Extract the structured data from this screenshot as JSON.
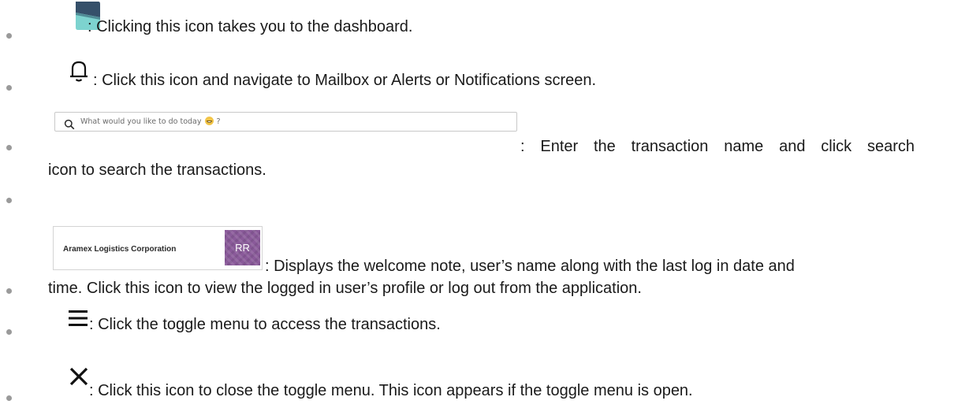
{
  "items": [
    {
      "icon": "dashboard-logo-icon",
      "text": ": Clicking this icon takes you to the dashboard."
    },
    {
      "icon": "bell-icon",
      "text": ": Click this icon and navigate to Mailbox or Alerts or Notifications screen."
    },
    {
      "icon": "search-icon",
      "search_placeholder_before": "What would you like to do today",
      "search_placeholder_after": "?",
      "emoji_icon": "grinning-face-icon",
      "text_line1": ": Enter the transaction name and click search",
      "text_line2": "icon to search the transactions."
    },
    {
      "text": ""
    },
    {
      "company": "Aramex Logistics Corporation",
      "avatar_initials": "RR",
      "text_line1": ": Displays the welcome note, user’s name along with the last log in date and",
      "text_line2": "time. Click this icon to view the logged in user’s profile or log out from the application."
    },
    {
      "icon": "hamburger-menu-icon",
      "text": ": Click the toggle menu to access the transactions."
    },
    {
      "icon": "close-icon",
      "text": ": Click this icon to close the toggle menu. This icon appears if the toggle menu is open."
    }
  ],
  "colors": {
    "text": "#1a1a1a",
    "bullet": "#9a9a9a",
    "dashboard_icon_dark": "#35506a",
    "dashboard_icon_teal": "#7dd3cf",
    "avatar": "#8a5a9a",
    "emoji": "#f2c548"
  }
}
